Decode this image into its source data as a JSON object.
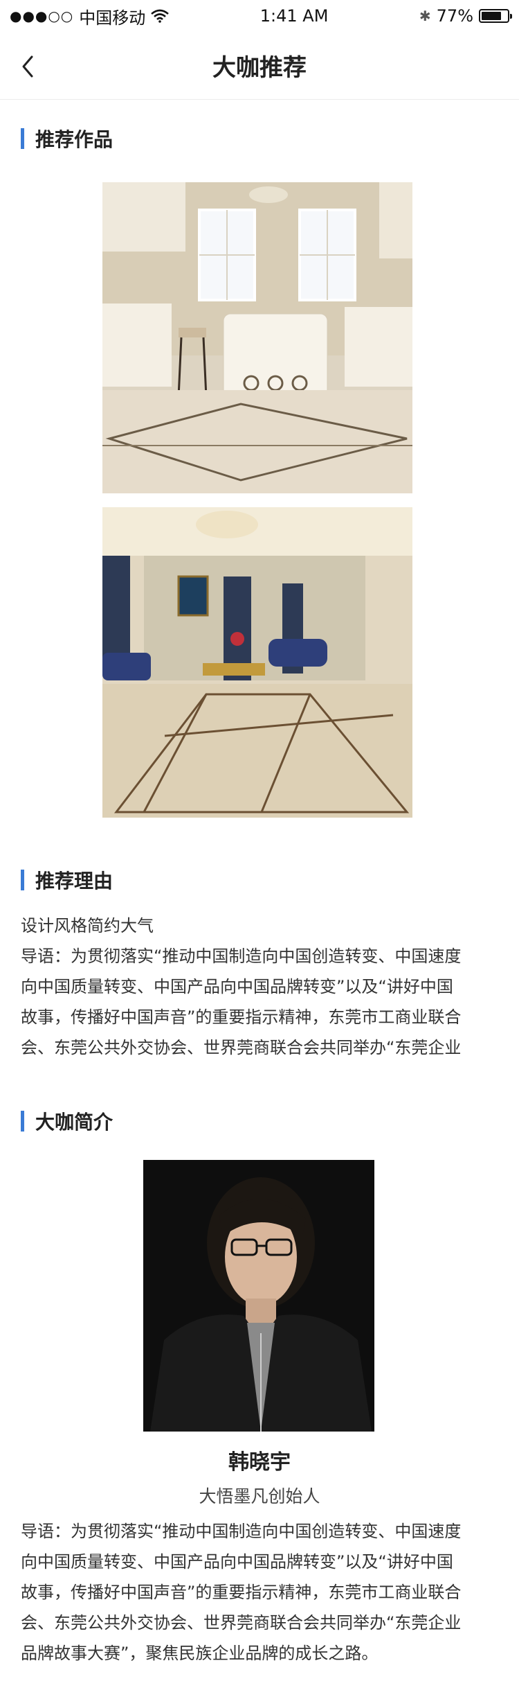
{
  "status_bar": {
    "signal_dots": "●●●○○",
    "carrier": "中国移动",
    "time": "1:41 AM",
    "bluetooth": "✱",
    "battery_percent": "77%",
    "battery_level": 0.77
  },
  "nav": {
    "title": "大咖推荐"
  },
  "works": {
    "title": "推荐作品",
    "images": [
      "kitchen-interior-photo",
      "living-room-interior-photo"
    ]
  },
  "reason": {
    "title": "推荐理由",
    "lines": [
      "设计风格简约大气",
      "导语：为贯彻落实“推动中国制造向中国创造转变、中国速度",
      "向中国质量转变、中国产品向中国品牌转变”以及“讲好中国",
      "故事，传播好中国声音”的重要指示精神，东莞市工商业联合",
      "会、东莞公共外交协会、世界莞商联合会共同举办“东莞企业"
    ]
  },
  "profile": {
    "title": "大咖简介",
    "name": "韩晓宇",
    "role": "大悟墨凡创始人",
    "lines": [
      "导语：为贯彻落实“推动中国制造向中国创造转变、中国速度",
      "向中国质量转变、中国产品向中国品牌转变”以及“讲好中国",
      "故事，传播好中国声音”的重要指示精神，东莞市工商业联合",
      "会、东莞公共外交协会、世界莞商联合会共同举办“东莞企业",
      "品牌故事大赛”，聚焦民族企业品牌的成长之路。"
    ]
  }
}
